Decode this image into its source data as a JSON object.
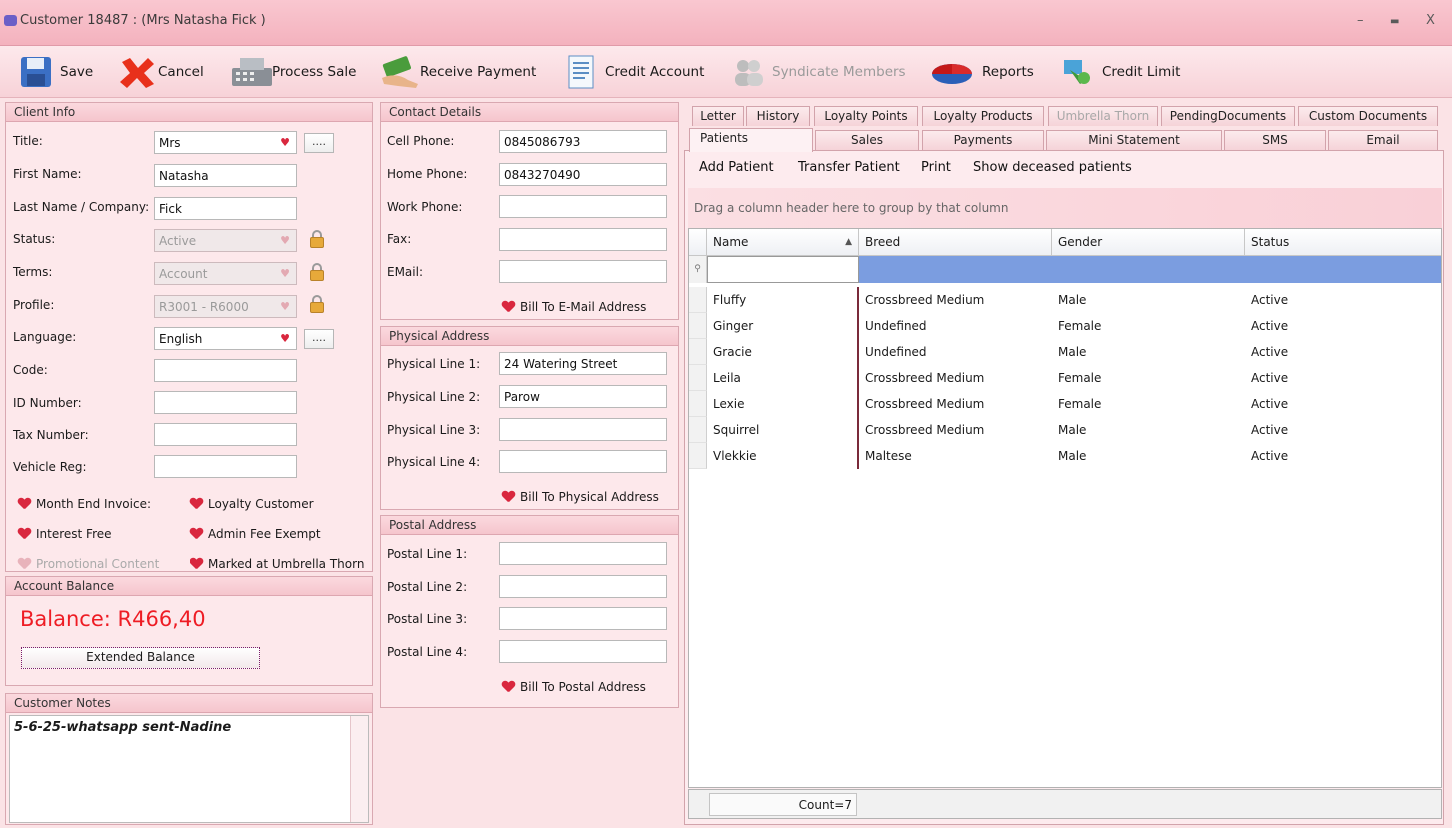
{
  "window": {
    "title": "Customer 18487 : (Mrs Natasha Fick )",
    "minimize": "–",
    "maximize": "▬",
    "close": "X"
  },
  "toolbar": {
    "save": "Save",
    "cancel": "Cancel",
    "process_sale": "Process Sale",
    "receive_payment": "Receive Payment",
    "credit_account": "Credit Account",
    "syndicate_members": "Syndicate Members",
    "reports": "Reports",
    "credit_limit": "Credit Limit"
  },
  "client_info": {
    "header": "Client Info",
    "title_label": "Title:",
    "title_value": "Mrs",
    "first_name_label": "First Name:",
    "first_name_value": "Natasha",
    "last_name_label": "Last Name / Company:",
    "last_name_value": "Fick",
    "status_label": "Status:",
    "status_value": "Active",
    "terms_label": "Terms:",
    "terms_value": "Account",
    "profile_label": "Profile:",
    "profile_value": "R3001 - R6000",
    "language_label": "Language:",
    "language_value": "English",
    "code_label": "Code:",
    "code_value": "",
    "id_label": "ID Number:",
    "id_value": "",
    "tax_label": "Tax Number:",
    "tax_value": "",
    "vehicle_label": "Vehicle Reg:",
    "vehicle_value": "",
    "ellipsis": "....",
    "month_end_invoice": "Month End Invoice:",
    "loyalty_customer": "Loyalty Customer",
    "interest_free": "Interest Free",
    "admin_fee_exempt": "Admin Fee Exempt",
    "promotional_content": "Promotional Content",
    "marked_umbrella": "Marked at Umbrella Thorn"
  },
  "account_balance": {
    "header": "Account Balance",
    "balance_text": "Balance: R466,40",
    "extended_button": "Extended Balance"
  },
  "customer_notes": {
    "header": "Customer Notes",
    "text": "5-6-25-whatsapp sent-Nadine"
  },
  "contact": {
    "header": "Contact Details",
    "cell_label": "Cell Phone:",
    "cell_value": "0845086793",
    "home_label": "Home Phone:",
    "home_value": "0843270490",
    "work_label": "Work Phone:",
    "work_value": "",
    "fax_label": "Fax:",
    "fax_value": "",
    "email_label": "EMail:",
    "email_value": "",
    "bill_email": "Bill To E-Mail Address"
  },
  "physical": {
    "header": "Physical Address",
    "l1_label": "Physical Line 1:",
    "l1_value": "24 Watering Street",
    "l2_label": "Physical Line 2:",
    "l2_value": "Parow",
    "l3_label": "Physical Line 3:",
    "l3_value": "",
    "l4_label": "Physical Line 4:",
    "l4_value": "",
    "bill_physical": "Bill To Physical Address"
  },
  "postal": {
    "header": "Postal Address",
    "l1_label": "Postal Line 1:",
    "l2_label": "Postal Line 2:",
    "l3_label": "Postal Line 3:",
    "l4_label": "Postal Line 4:",
    "bill_postal": "Bill To Postal Address"
  },
  "tabs_row1": [
    "Letter",
    "History",
    "Loyalty Points",
    "Loyalty Products",
    "Umbrella Thorn",
    "PendingDocuments",
    "Custom Documents"
  ],
  "tabs_row2": [
    "Patients",
    "Sales",
    "Payments",
    "Mini Statement",
    "SMS",
    "Email"
  ],
  "patients": {
    "add": "Add Patient",
    "transfer": "Transfer Patient",
    "print": "Print",
    "show_deceased": "Show deceased patients",
    "group_hint": "Drag a column header here to group by that column",
    "columns": [
      "Name",
      "Breed",
      "Gender",
      "Status"
    ],
    "rows": [
      [
        "Fluffy",
        "Crossbreed Medium",
        "Male",
        "Active"
      ],
      [
        "Ginger",
        "Undefined",
        "Female",
        "Active"
      ],
      [
        "Gracie",
        "Undefined",
        "Male",
        "Active"
      ],
      [
        "Leila",
        "Crossbreed Medium",
        "Female",
        "Active"
      ],
      [
        "Lexie",
        "Crossbreed Medium",
        "Female",
        "Active"
      ],
      [
        "Squirrel",
        "Crossbreed Medium",
        "Male",
        "Active"
      ],
      [
        "Vlekkie",
        "Maltese",
        "Male",
        "Active"
      ]
    ],
    "count": "Count=7"
  }
}
